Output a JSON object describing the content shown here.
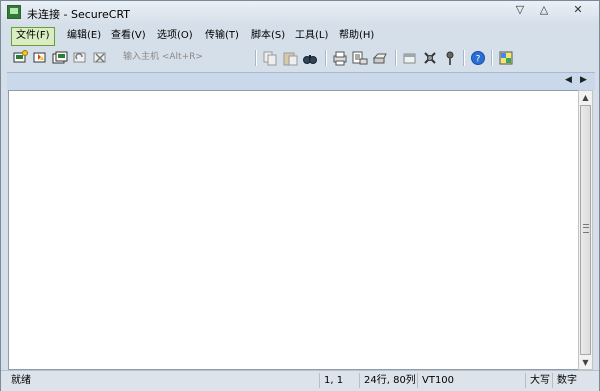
{
  "window": {
    "title": "未连接 - SecureCRT"
  },
  "window_buttons": {
    "minimize": "▽",
    "maximize": "△",
    "close": "✕"
  },
  "menu": [
    {
      "label": "文件(F)",
      "active": true
    },
    {
      "label": "编辑(E)"
    },
    {
      "label": "查看(V)"
    },
    {
      "label": "选项(O)"
    },
    {
      "label": "传输(T)"
    },
    {
      "label": "脚本(S)"
    },
    {
      "label": "工具(L)"
    },
    {
      "label": "帮助(H)"
    }
  ],
  "toolbar": {
    "quick_connect_placeholder": "输入主机 <Alt+R>",
    "buttons": [
      "connect-icon",
      "quick-connect-icon",
      "connect-tab-icon",
      "reconnect-icon",
      "disconnect-icon",
      "copy-icon",
      "paste-icon",
      "find-icon",
      "print-icon",
      "print-selection-icon",
      "printer-icon",
      "session-options-icon",
      "global-options-icon",
      "keymap-icon",
      "help-icon",
      "sftp-icon"
    ]
  },
  "tabbar": {
    "left_arrow": "◀",
    "right_arrow": "▶"
  },
  "scrollbar": {
    "up": "▲",
    "down": "▼"
  },
  "status": {
    "ready": "就绪",
    "cursor": "1,  1",
    "size": "24行, 80列",
    "emulation": "VT100",
    "caps": "大写",
    "num": "数字"
  }
}
